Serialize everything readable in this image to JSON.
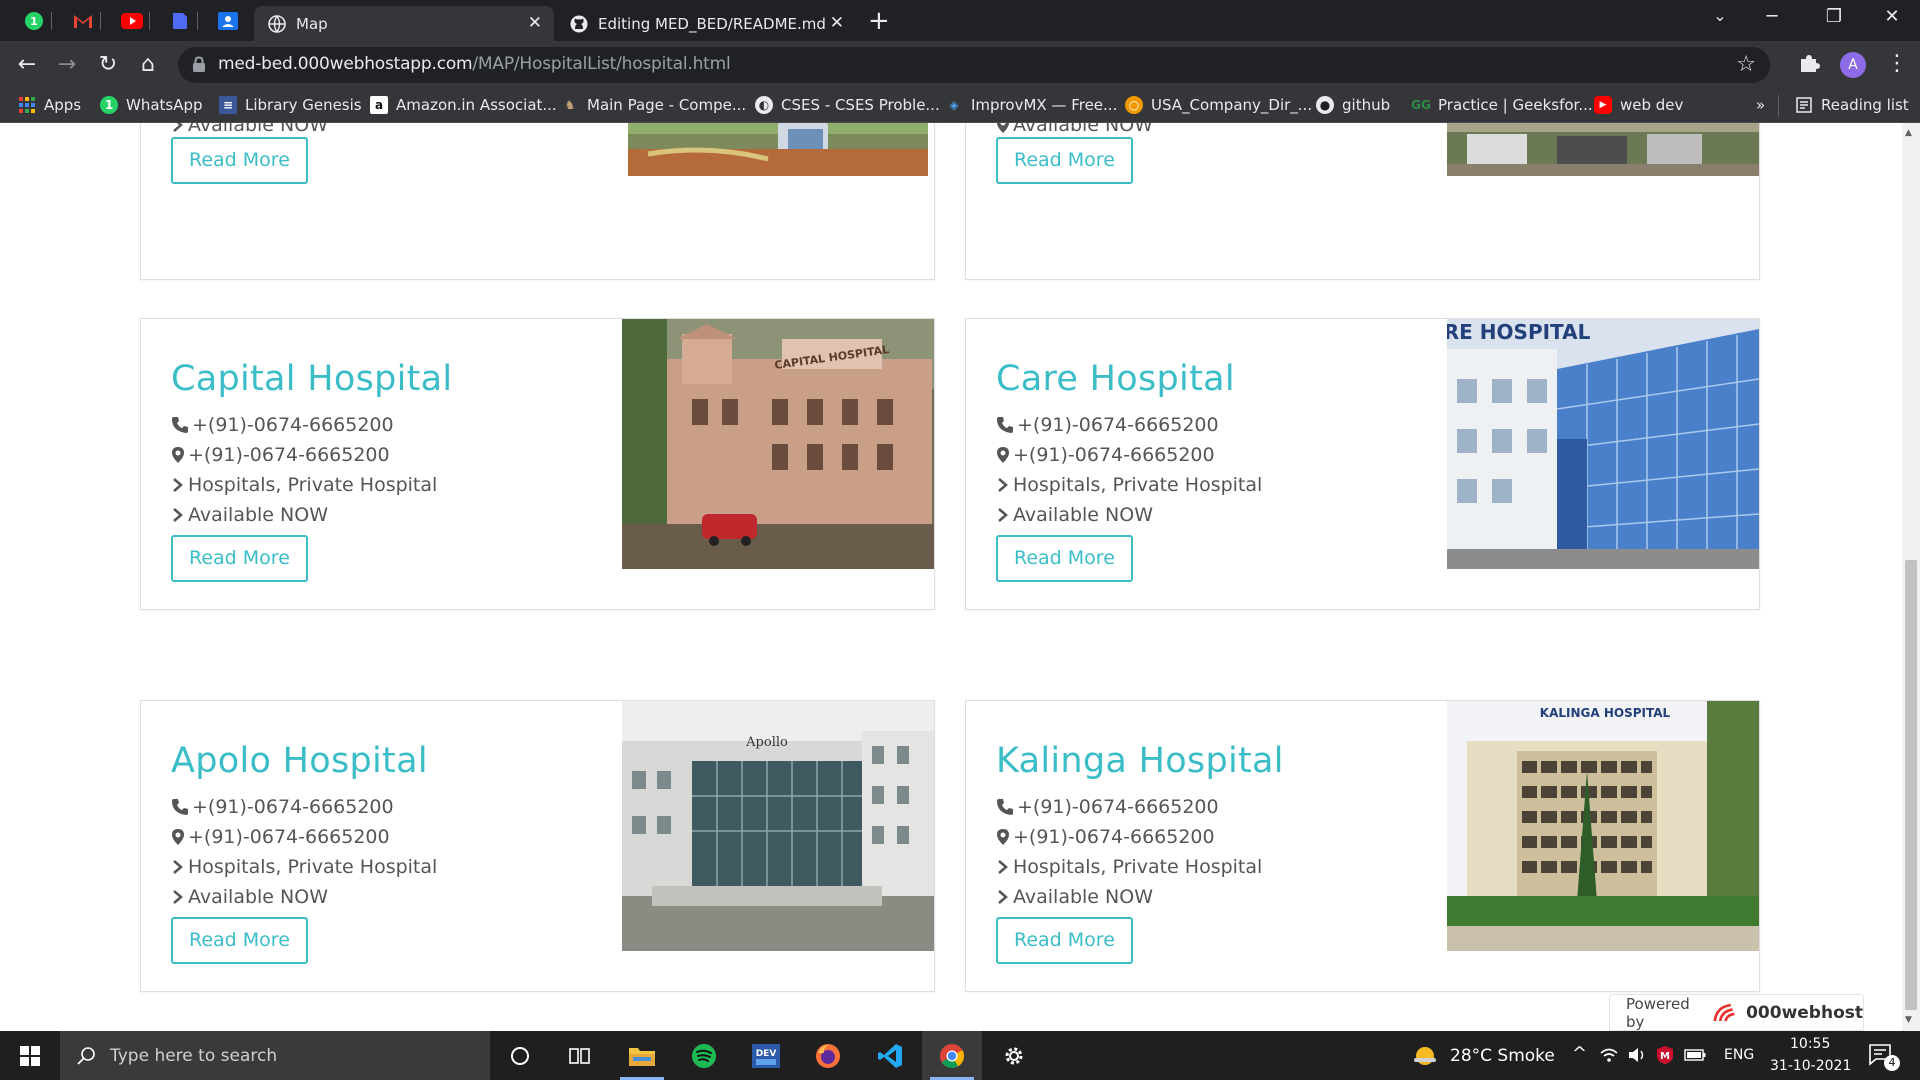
{
  "browser": {
    "tabs": [
      {
        "title": "Map",
        "active": true
      },
      {
        "title": "Editing MED_BED/README.md at",
        "active": false
      }
    ],
    "url_host": "med-bed.000webhostapp.com",
    "url_path": "/MAP/HospitalList/hospital.html",
    "profile_initial": "A",
    "bookmarks": [
      {
        "label": "Apps"
      },
      {
        "label": "WhatsApp"
      },
      {
        "label": "Library Genesis"
      },
      {
        "label": "Amazon.in Associat..."
      },
      {
        "label": "Main Page - Compe..."
      },
      {
        "label": "CSES - CSES Proble..."
      },
      {
        "label": "ImprovMX — Free..."
      },
      {
        "label": "USA_Company_Dir_..."
      },
      {
        "label": "github"
      },
      {
        "label": "Practice | Geeksfor..."
      },
      {
        "label": "web dev"
      }
    ],
    "bookmarks_overflow": "»",
    "reading_list": "Reading list"
  },
  "hospitals": [
    {
      "name": "",
      "phone": "",
      "address": "",
      "category": "",
      "status": "Available NOW",
      "button": "Read More"
    },
    {
      "name": "",
      "phone": "",
      "address": "",
      "category": "",
      "status": "Available NOW",
      "button": "Read More"
    },
    {
      "name": "Capital Hospital",
      "phone": "+(91)-0674-6665200",
      "address": "+(91)-0674-6665200",
      "category": "Hospitals, Private Hospital",
      "status": "Available NOW",
      "button": "Read More",
      "photo_sign": "CAPITAL HOSPITAL"
    },
    {
      "name": "Care Hospital",
      "phone": "+(91)-0674-6665200",
      "address": "+(91)-0674-6665200",
      "category": "Hospitals, Private Hospital",
      "status": "Available NOW",
      "button": "Read More",
      "photo_sign": "CARE HOSPITAL"
    },
    {
      "name": "Apolo Hospital",
      "phone": "+(91)-0674-6665200",
      "address": "+(91)-0674-6665200",
      "category": "Hospitals, Private Hospital",
      "status": "Available NOW",
      "button": "Read More",
      "photo_sign": "Apollo"
    },
    {
      "name": "Kalinga Hospital",
      "phone": "+(91)-0674-6665200",
      "address": "+(91)-0674-6665200",
      "category": "Hospitals, Private Hospital",
      "status": "Available NOW",
      "button": "Read More",
      "photo_sign": "KALINGA HOSPITAL"
    }
  ],
  "powered_by": {
    "label": "Powered by",
    "brand": "000webhost"
  },
  "taskbar": {
    "search_placeholder": "Type here to search",
    "weather": "28°C  Smoke",
    "language": "ENG",
    "time": "10:55",
    "date": "31-10-2021",
    "notification_count": "4"
  }
}
